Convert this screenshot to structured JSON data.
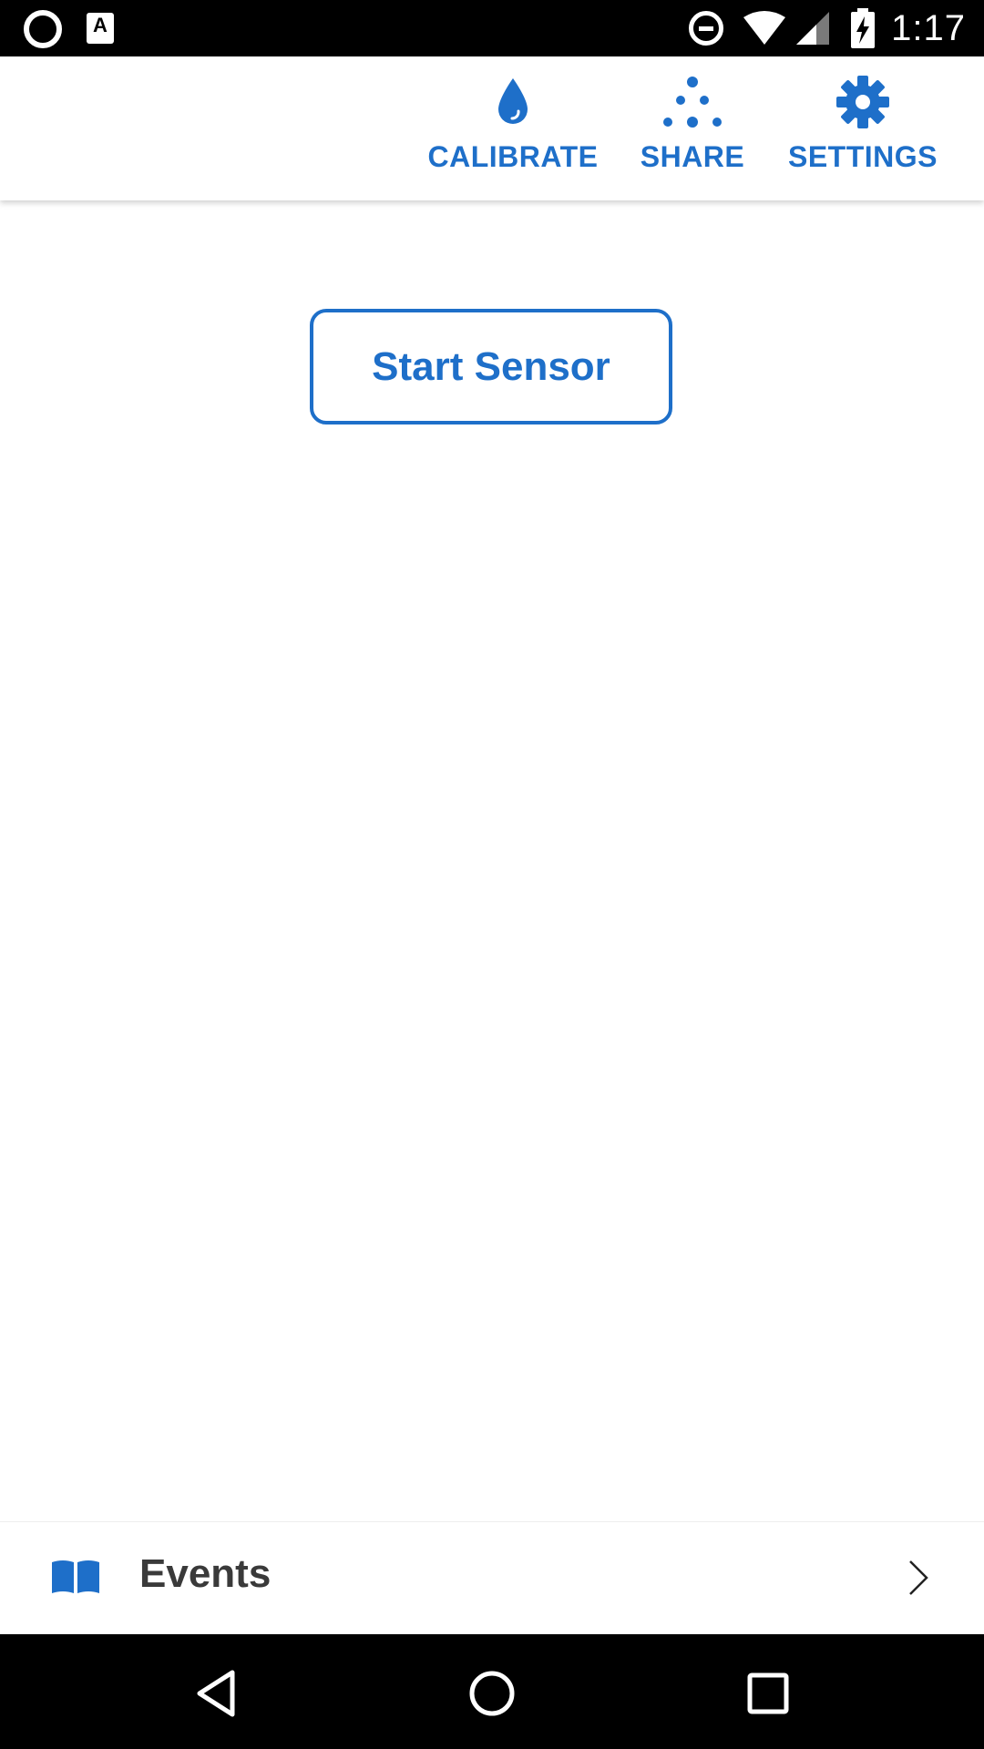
{
  "status_bar": {
    "time": "1:17",
    "left_icons": [
      "ring-icon",
      "a-icon"
    ],
    "right_icons": [
      "do-not-disturb-icon",
      "wifi-icon",
      "signal-icon",
      "battery-charging-icon"
    ]
  },
  "toolbar": {
    "calibrate_label": "CALIBRATE",
    "share_label": "SHARE",
    "settings_label": "SETTINGS",
    "icons": {
      "calibrate": "drop-icon",
      "share": "dots-icon",
      "settings": "gear-icon"
    }
  },
  "main": {
    "start_sensor_label": "Start Sensor"
  },
  "events": {
    "label": "Events",
    "icon": "book-icon",
    "chevron": "chevron-right-icon"
  },
  "nav_bar": {
    "icons": [
      "back-icon",
      "home-icon",
      "recents-icon"
    ]
  },
  "colors": {
    "accent": "#1e6fc9",
    "text_dark": "#3a3a3a",
    "bar_black": "#000000"
  }
}
